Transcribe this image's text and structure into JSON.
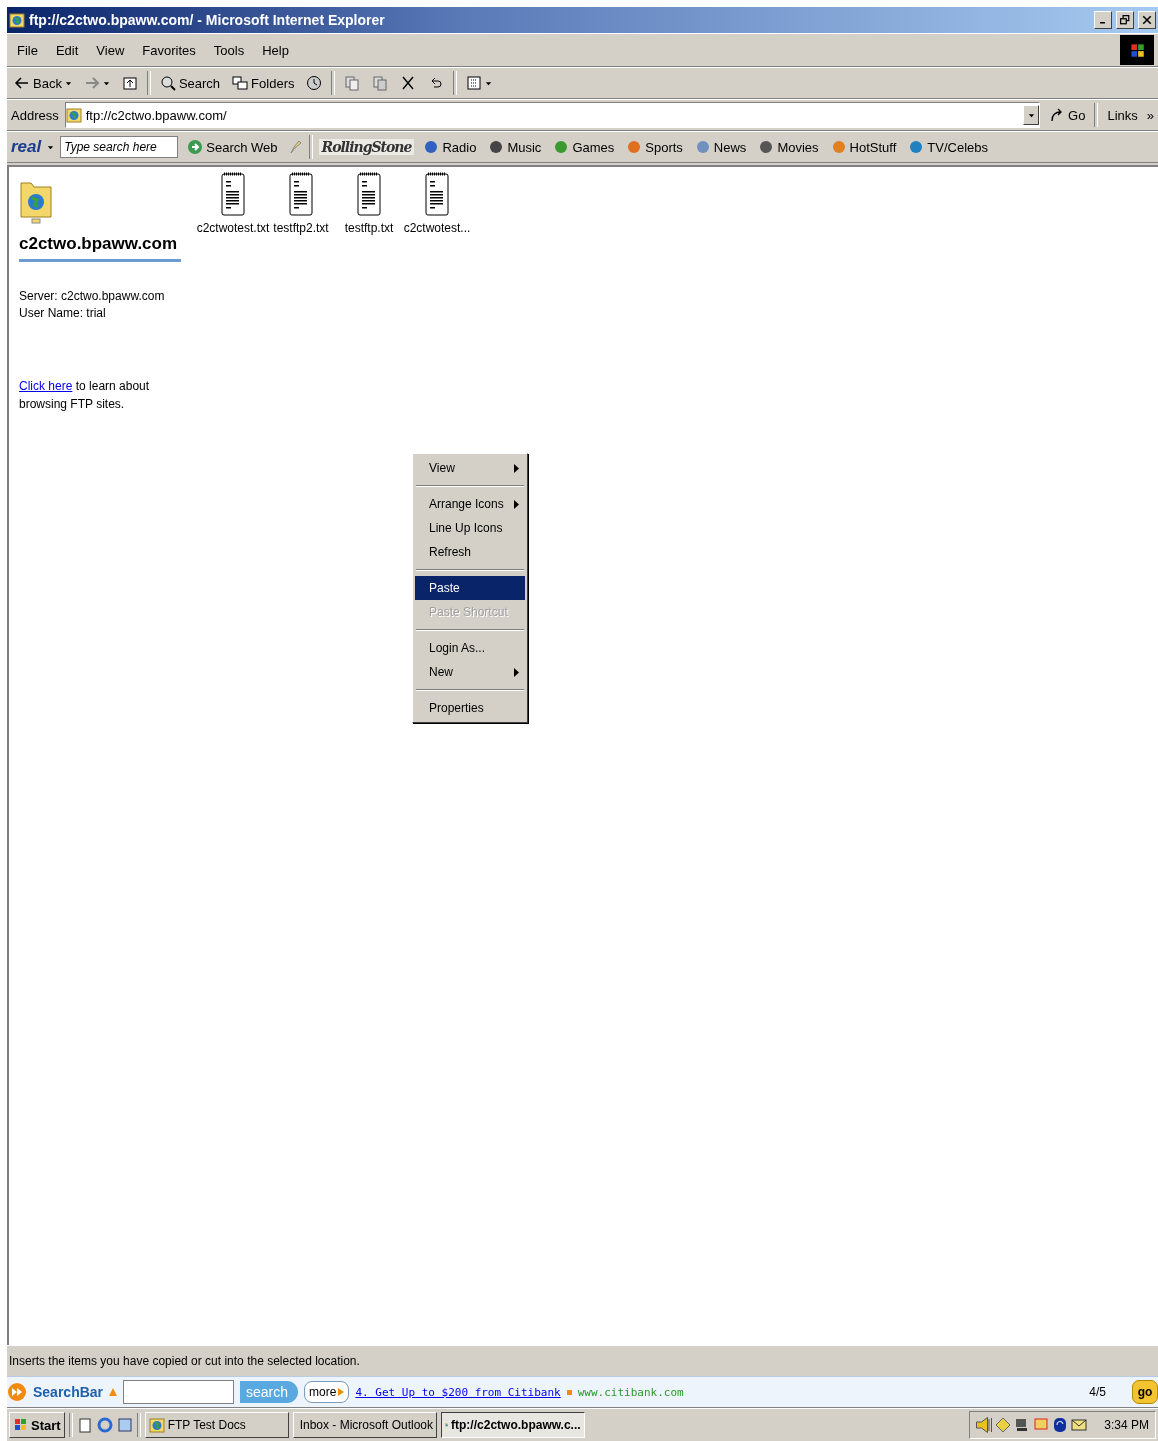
{
  "window": {
    "title": "ftp://c2ctwo.bpaww.com/ - Microsoft Internet Explorer"
  },
  "menu_bar": [
    "File",
    "Edit",
    "View",
    "Favorites",
    "Tools",
    "Help"
  ],
  "toolbar": {
    "groups": [
      [
        {
          "label": "Back",
          "dropdown": true
        },
        {
          "dropdown": true
        },
        {
          "dropdown": false
        }
      ],
      [
        {
          "label": "Search",
          "dropdown": false
        },
        {
          "label": "Folders",
          "dropdown": false
        },
        {
          "dropdown": false
        }
      ],
      [
        {
          "dropdown": false
        },
        {
          "dropdown": false
        },
        {
          "dropdown": false
        },
        {
          "dropdown": false
        }
      ],
      [
        {
          "dropdown": true
        }
      ]
    ]
  },
  "address_bar": {
    "label": "Address",
    "value": "ftp://c2ctwo.bpaww.com/",
    "go": "Go",
    "links": "Links",
    "more": "»"
  },
  "real_bar": {
    "logo": "real",
    "placeholder": "Type search here",
    "search_button": "Search Web",
    "brand": "RollingStone",
    "links": [
      "Radio",
      "Music",
      "Games",
      "Sports",
      "News",
      "Movies",
      "HotStuff",
      "TV/Celebs"
    ]
  },
  "folder_panel": {
    "title": "c2ctwo.bpaww.com",
    "info": [
      "Server: c2ctwo.bpaww.com",
      "User Name: trial"
    ],
    "help_link": "Click here",
    "help_text": " to learn about browsing FTP sites."
  },
  "files": [
    {
      "name": "c2ctwotest.txt"
    },
    {
      "name": "testftp2.txt"
    },
    {
      "name": "testftp.txt"
    },
    {
      "name": "c2ctwotest..."
    }
  ],
  "context_menu": [
    {
      "kind": "item",
      "label": "View",
      "submenu": true,
      "selected": false,
      "disabled": false
    },
    {
      "kind": "separator"
    },
    {
      "kind": "item",
      "label": "Arrange Icons",
      "submenu": true,
      "selected": false,
      "disabled": false
    },
    {
      "kind": "item",
      "label": "Line Up Icons",
      "submenu": false,
      "selected": false,
      "disabled": false
    },
    {
      "kind": "item",
      "label": "Refresh",
      "submenu": false,
      "selected": false,
      "disabled": false
    },
    {
      "kind": "separator"
    },
    {
      "kind": "item",
      "label": "Paste",
      "submenu": false,
      "selected": true,
      "disabled": false
    },
    {
      "kind": "item",
      "label": "Paste Shortcut",
      "submenu": false,
      "selected": false,
      "disabled": true
    },
    {
      "kind": "separator"
    },
    {
      "kind": "item",
      "label": "Login As...",
      "submenu": false,
      "selected": false,
      "disabled": false
    },
    {
      "kind": "item",
      "label": "New",
      "submenu": true,
      "selected": false,
      "disabled": false
    },
    {
      "kind": "separator"
    },
    {
      "kind": "item",
      "label": "Properties",
      "submenu": false,
      "selected": false,
      "disabled": false
    }
  ],
  "status_bar": {
    "text": "Inserts the items you have copied or cut into the selected location."
  },
  "search_bar": {
    "label": "SearchBar",
    "search_button": "search",
    "more": "more",
    "ad_link": "4. Get Up to $200 from Citibank",
    "ad_url": "www.citibank.com",
    "counter": "4/5",
    "go": "go"
  },
  "taskbar": {
    "start": "Start",
    "tasks": [
      {
        "label": "FTP Test Docs",
        "selected": false
      },
      {
        "label": "Inbox - Microsoft Outlook",
        "selected": false
      },
      {
        "label": "ftp://c2ctwo.bpaww.c...",
        "selected": true
      }
    ],
    "clock": "3:34 PM"
  }
}
